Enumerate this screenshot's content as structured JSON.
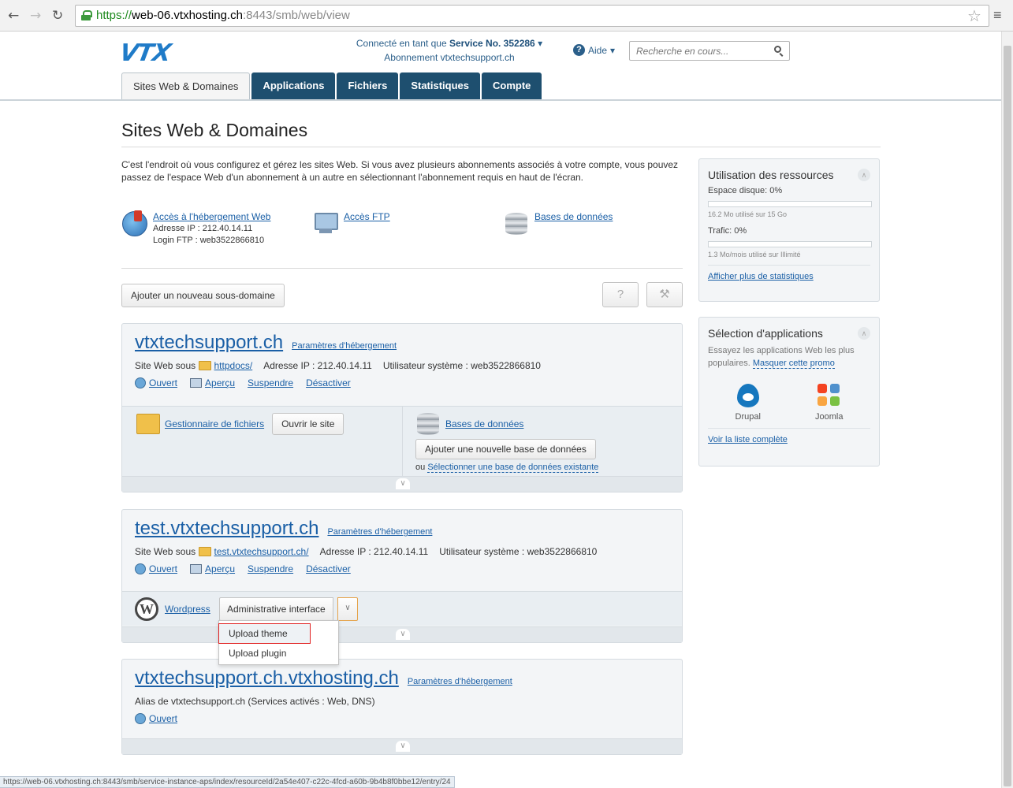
{
  "browser": {
    "url_scheme": "https://",
    "url_host": "web-06.vtxhosting.ch",
    "url_rest": ":8443/smb/web/view",
    "status_url": "https://web-06.vtxhosting.ch:8443/smb/service-instance-aps/index/resourceId/2a54e407-c22c-4fcd-a60b-9b4b8f0bbe12/entry/24"
  },
  "header": {
    "logo": "VTX",
    "connected_label": "Connecté en tant que",
    "service": "Service No. 352286",
    "subscription_label": "Abonnement",
    "subscription": "vtxtechsupport.ch",
    "help": "Aide",
    "search_placeholder": "Recherche en cours..."
  },
  "tabs": [
    {
      "label": "Sites Web & Domaines",
      "active": true
    },
    {
      "label": "Applications"
    },
    {
      "label": "Fichiers"
    },
    {
      "label": "Statistiques"
    },
    {
      "label": "Compte"
    }
  ],
  "page": {
    "title": "Sites Web & Domaines",
    "intro": "C'est l'endroit où vous configurez et gérez les sites Web. Si vous avez plusieurs abonnements associés à votre compte, vous pouvez passez de l'espace Web d'un abonnement à un autre en sélectionnant l'abonnement requis en haut de l'écran.",
    "quick": {
      "hosting_link": "Accès à l'hébergement Web",
      "ip_line": "Adresse IP : 212.40.14.11",
      "ftp_line": "Login FTP : web3522866810",
      "ftp_link": "Accès FTP",
      "db_link": "Bases de données"
    },
    "add_subdomain": "Ajouter un nouveau sous-domaine",
    "help_btn": "?"
  },
  "domains": [
    {
      "name": "vtxtechsupport.ch",
      "params": "Paramètres d'hébergement",
      "site_label": "Site Web sous",
      "folder": "httpdocs/",
      "ip": "Adresse IP : 212.40.14.11",
      "user": "Utilisateur système : web3522866810",
      "open": "Ouvert",
      "preview": "Aperçu",
      "suspend": "Suspendre",
      "disable": "Désactiver",
      "file_manager": "Gestionnaire de fichiers",
      "open_site": "Ouvrir le site",
      "databases": "Bases de données",
      "add_db": "Ajouter une nouvelle base de données",
      "or": "ou",
      "select_db": "Sélectionner une base de données existante"
    },
    {
      "name": "test.vtxtechsupport.ch",
      "params": "Paramètres d'hébergement",
      "site_label": "Site Web sous",
      "folder": "test.vtxtechsupport.ch/",
      "ip": "Adresse IP : 212.40.14.11",
      "user": "Utilisateur système : web3522866810",
      "open": "Ouvert",
      "preview": "Aperçu",
      "suspend": "Suspendre",
      "disable": "Désactiver",
      "wordpress": "Wordpress",
      "admin_interface": "Administrative interface"
    },
    {
      "name": "vtxtechsupport.ch.vtxhosting.ch",
      "params": "Paramètres d'hébergement",
      "alias": "Alias de vtxtechsupport.ch (Services activés : Web, DNS)",
      "open": "Ouvert"
    }
  ],
  "dropdown": {
    "items": [
      "Upload theme",
      "Upload plugin"
    ]
  },
  "resources": {
    "title": "Utilisation des ressources",
    "disk_label": "Espace disque: 0%",
    "disk_usage": 0,
    "disk_detail": "16.2 Mo utilisé sur 15 Go",
    "traffic_label": "Trafic: 0%",
    "traffic_usage": 0,
    "traffic_detail": "1.3 Mo/mois utilisé sur Illimité",
    "more_stats": "Afficher plus de statistiques"
  },
  "apps": {
    "title": "Sélection d'applications",
    "desc": "Essayez les applications Web les plus populaires.",
    "hide_promo": "Masquer cette promo",
    "items": [
      "Drupal",
      "Joomla"
    ],
    "full_list": "Voir la liste complète"
  }
}
